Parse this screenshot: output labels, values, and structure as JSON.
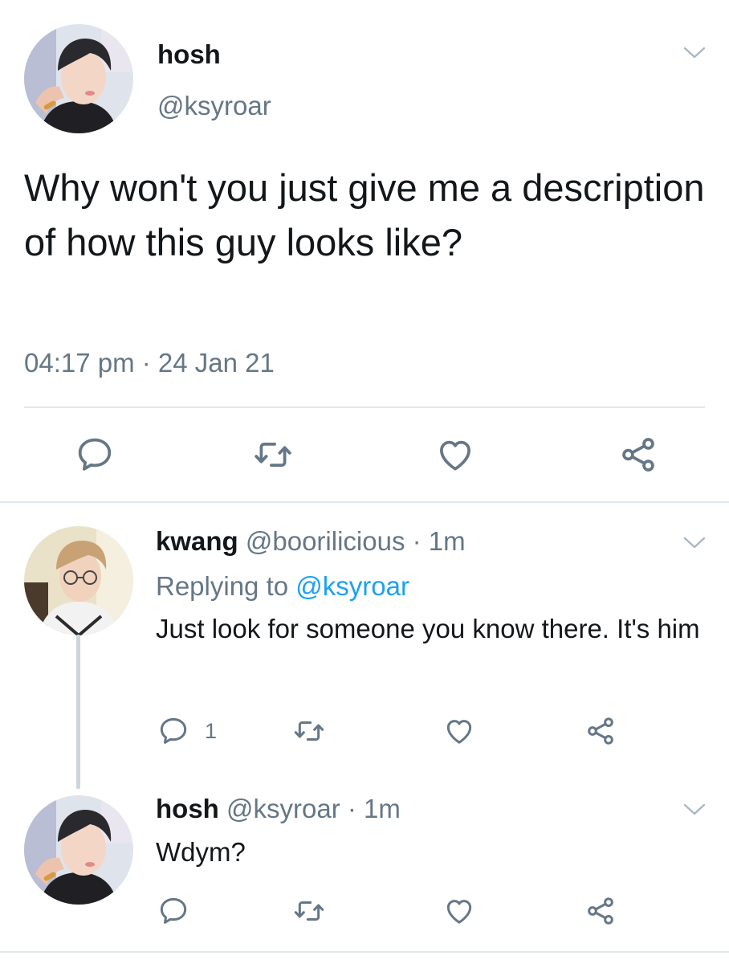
{
  "main_tweet": {
    "name": "hosh",
    "handle": "@ksyroar",
    "text": "Why won't you just give me a description of how this guy looks like?",
    "timestamp": "04:17 pm · 24 Jan 21"
  },
  "replies": [
    {
      "name": "kwang",
      "meta": "@boorilicious · 1m",
      "replying_prefix": "Replying to ",
      "replying_to": "@ksyroar",
      "text": "Just look for someone you know there. It's him",
      "reply_count": "1"
    },
    {
      "name": "hosh",
      "meta": "@ksyroar · 1m",
      "text": "Wdym?"
    }
  ],
  "icons": [
    "reply-icon",
    "retweet-icon",
    "like-icon",
    "share-icon",
    "chevron-down-icon"
  ],
  "colors": {
    "text": "#14171a",
    "secondary": "#657786",
    "link": "#1da1f2",
    "divider": "#e1e8ed",
    "thread_line": "#ccd6dd"
  }
}
